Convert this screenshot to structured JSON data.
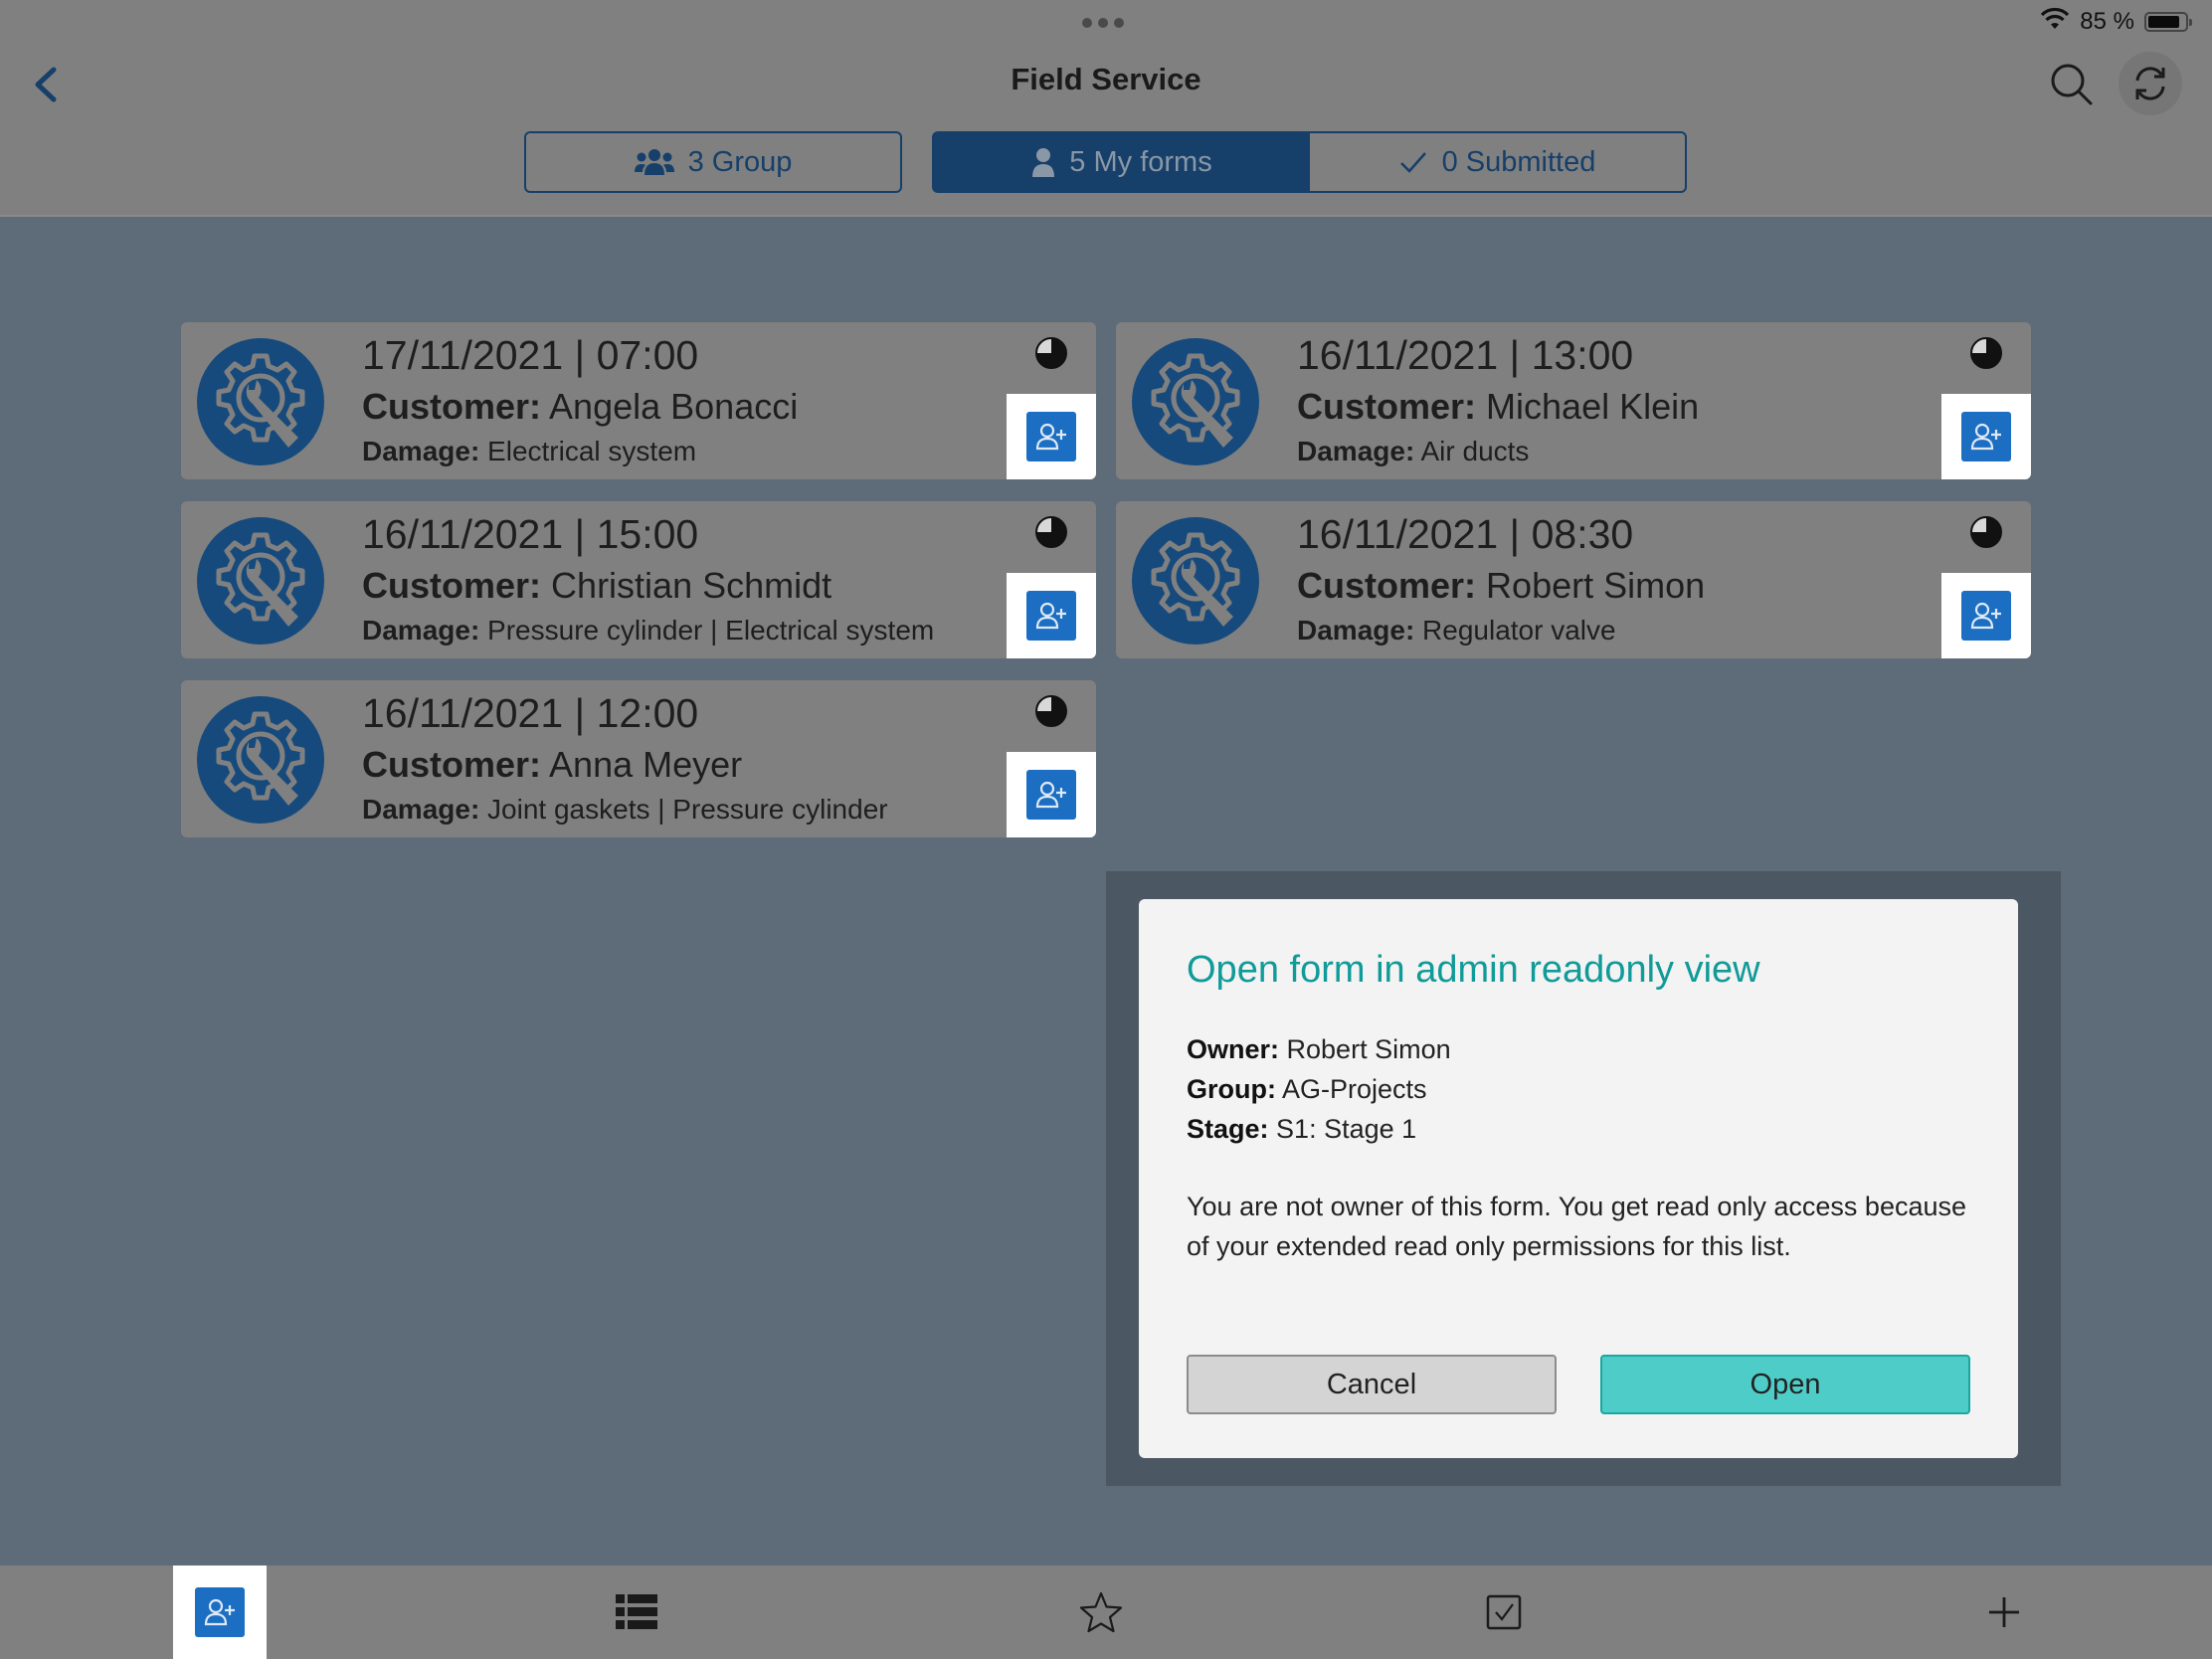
{
  "status_bar": {
    "battery_text": "85 %",
    "battery_level_percent": 85,
    "wifi_icon": "wifi-icon"
  },
  "header": {
    "title": "Field Service",
    "back_icon": "chevron-left-icon",
    "search_icon": "search-icon",
    "refresh_icon": "refresh-icon"
  },
  "segments": [
    {
      "icon": "group-icon",
      "count": "3",
      "label": "Group",
      "text": "3 Group",
      "selected": false
    },
    {
      "icon": "user-icon",
      "count": "5",
      "label": "My forms",
      "text": "5 My forms",
      "selected": true
    },
    {
      "icon": "check-icon",
      "count": "0",
      "label": "Submitted",
      "text": "0 Submitted",
      "selected": false
    }
  ],
  "forms": [
    {
      "datetime": "17/11/2021 | 07:00",
      "customer_label": "Customer:",
      "customer": "Angela Bonacci",
      "damage_label": "Damage:",
      "damage": "Electrical system",
      "progress_fraction": 0.75
    },
    {
      "datetime": "16/11/2021 | 13:00",
      "customer_label": "Customer:",
      "customer": "Michael Klein",
      "damage_label": "Damage:",
      "damage": "Air ducts",
      "progress_fraction": 0.75
    },
    {
      "datetime": "16/11/2021 | 15:00",
      "customer_label": "Customer:",
      "customer": "Christian Schmidt",
      "damage_label": "Damage:",
      "damage": "Pressure cylinder | Electrical system",
      "progress_fraction": 0.75
    },
    {
      "datetime": "16/11/2021 | 08:30",
      "customer_label": "Customer:",
      "customer": "Robert Simon",
      "damage_label": "Damage:",
      "damage": "Regulator valve",
      "progress_fraction": 0.75
    },
    {
      "datetime": "16/11/2021 | 12:00",
      "customer_label": "Customer:",
      "customer": "Anna Meyer",
      "damage_label": "Damage:",
      "damage": "Joint gaskets | Pressure cylinder",
      "progress_fraction": 0.75
    }
  ],
  "dialog": {
    "title": "Open form in admin readonly view",
    "owner_label": "Owner:",
    "owner": "Robert Simon",
    "group_label": "Group:",
    "group": "AG-Projects",
    "stage_label": "Stage:",
    "stage": "S1: Stage 1",
    "message": "You are not owner of this form. You get read only access because of your extended read only permissions for this list.",
    "cancel_label": "Cancel",
    "open_label": "Open"
  },
  "bottom_tabs": [
    {
      "icon": "assign-user-icon",
      "active": true
    },
    {
      "icon": "list-icon",
      "active": false
    },
    {
      "icon": "star-icon",
      "active": false
    },
    {
      "icon": "checkbox-icon",
      "active": false
    },
    {
      "icon": "plus-icon",
      "active": false
    }
  ],
  "colors": {
    "brand_blue": "#163f69",
    "assign_blue": "#1b6ec2",
    "dialog_title": "#109a98",
    "open_button": "#4ecdc8"
  }
}
